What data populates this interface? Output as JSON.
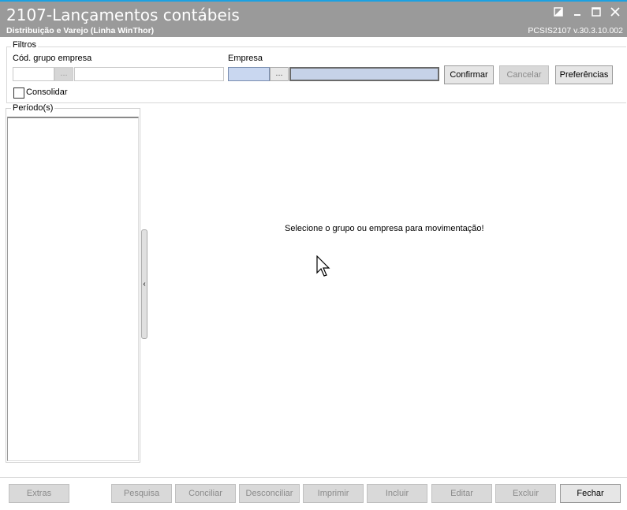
{
  "window": {
    "title": "2107-Lançamentos contábeis",
    "subtitle": "Distribuição e Varejo (Linha WinThor)",
    "version": "PCSIS2107  v.30.3.10.002",
    "controls": [
      "restore-icon",
      "minimize-icon",
      "maximize-icon",
      "close-icon"
    ]
  },
  "filters": {
    "legend": "Filtros",
    "cod_grupo_label": "Cód. grupo empresa",
    "cod_grupo_value": "",
    "cod_grupo_desc": "",
    "empresa_label": "Empresa",
    "empresa_value": "",
    "empresa_desc": "",
    "dots": "...",
    "consolidar_label": "Consolidar",
    "consolidar_checked": false
  },
  "buttons": {
    "confirmar": "Confirmar",
    "cancelar": "Cancelar",
    "preferencias": "Preferências"
  },
  "periodos": {
    "legend": "Período(s)",
    "items": []
  },
  "main": {
    "message": "Selecione o grupo ou empresa para movimentação!"
  },
  "toolbar": {
    "extras": "Extras",
    "pesquisa": "Pesquisa",
    "conciliar": "Conciliar",
    "desconciliar": "Desconciliar",
    "imprimir": "Imprimir",
    "incluir": "Incluir",
    "editar": "Editar",
    "excluir": "Excluir",
    "fechar": "Fechar"
  },
  "colors": {
    "accent_border": "#1ba1e2",
    "titlebar": "#9a9a9a",
    "selected_field": "#c9d7f0"
  }
}
